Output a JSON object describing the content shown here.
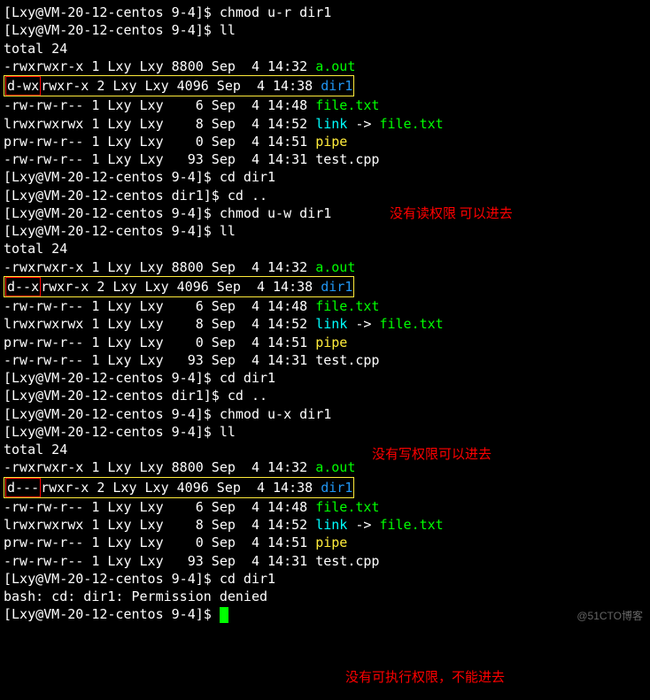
{
  "prompt": {
    "user": "Lxy",
    "host": "VM-20-12-centos",
    "p1": "[Lxy@VM-20-12-centos 9-4]$ ",
    "p2": "[Lxy@VM-20-12-centos dir1]$ "
  },
  "commands": {
    "chmod_ur": "chmod u-r dir1",
    "chmod_uw": "chmod u-w dir1",
    "chmod_ux": "chmod u-x dir1",
    "ll": "ll",
    "cd_dir1": "cd dir1",
    "cd_up": "cd ..",
    "total": "total 24"
  },
  "perms": {
    "aout": "-rwxrwxr-x",
    "dir1_wx": "d-wx",
    "dir1_x": "d--x",
    "dir1_none": "d---",
    "dir1_rest": "rwxr-x",
    "file": "-rw-rw-r--",
    "link": "lrwxrwxrwx",
    "pipe": "prw-rw-r--",
    "test": "-rw-rw-r--"
  },
  "listing": {
    "aout": " 1 Lxy Lxy 8800 Sep  4 14:32 ",
    "dir1": " 2 Lxy Lxy 4096 Sep  4 14:38 ",
    "file": " 1 Lxy Lxy    6 Sep  4 14:48 ",
    "link": " 1 Lxy Lxy    8 Sep  4 14:52 ",
    "pipe": " 1 Lxy Lxy    0 Sep  4 14:51 ",
    "test": " 1 Lxy Lxy   93 Sep  4 14:31 "
  },
  "names": {
    "aout": "a.out",
    "dir1": "dir1",
    "file": "file.txt",
    "link": "link",
    "link_arrow": " -> ",
    "pipe": "pipe",
    "test": "test.cpp"
  },
  "error": {
    "denied": "bash: cd: dir1: Permission denied"
  },
  "annotations": {
    "no_read": "没有读权限  可以进去",
    "no_write": "没有写权限可以进去",
    "no_exec": "没有可执行权限，不能进去"
  },
  "watermark": "@51CTO博客"
}
